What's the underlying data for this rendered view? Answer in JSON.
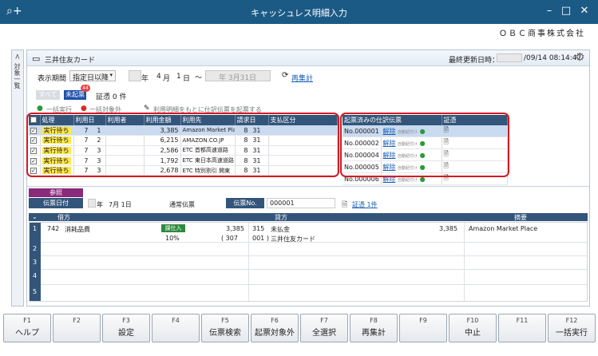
{
  "window": {
    "title": "キャッシュレス明細入力",
    "company": "ＯＢＣ商事株式会社"
  },
  "side_label": "対象一覧",
  "card": {
    "name": "三井住友カード",
    "updated_label": "最終更新日時：",
    "updated_value": "/09/14 08:14:47"
  },
  "filter": {
    "period_label": "表示期間",
    "period_select": "指定日以降",
    "from_year_label": "年",
    "from_month": "4",
    "from_month_label": "月",
    "from_day": "1",
    "from_day_label": "日",
    "tilde": "～",
    "to_value": "年  3月31日",
    "recalc_label": "再集計"
  },
  "tabs": {
    "all": "すべて",
    "unposted": "未起票",
    "badge": "44",
    "voucher": "証憑 0 件"
  },
  "actions": {
    "bulk_exec": "一括実行",
    "bulk_exclude": "一括対象外",
    "hint": "利用明細をもとに仕訳伝票を起票する"
  },
  "left_table": {
    "headers": [
      "",
      "処理",
      "利用日",
      "利用者",
      "利用金額",
      "利用先",
      "請求日",
      "支払区分"
    ],
    "rows": [
      {
        "status": "実行待ち",
        "m": "7",
        "d": "1",
        "amount": "3,385",
        "merchant": "Amazon Market Place",
        "bm": "8",
        "bd": "31"
      },
      {
        "status": "実行待ち",
        "m": "7",
        "d": "2",
        "amount": "6,215",
        "merchant": "AMAZON.CO.JP",
        "bm": "8",
        "bd": "31"
      },
      {
        "status": "実行待ち",
        "m": "7",
        "d": "3",
        "amount": "2,586",
        "merchant": "ETC 首都高速道路",
        "bm": "8",
        "bd": "31"
      },
      {
        "status": "実行待ち",
        "m": "7",
        "d": "3",
        "amount": "1,792",
        "merchant": "ETC 東日本高速道路 関東支社",
        "bm": "8",
        "bd": "31"
      },
      {
        "status": "実行待ち",
        "m": "7",
        "d": "3",
        "amount": "2,678",
        "merchant": "ETC 特別割引 開東",
        "bm": "8",
        "bd": "31"
      }
    ]
  },
  "right_table": {
    "headers": [
      "起票済みの仕訳伝票",
      "",
      "証憑"
    ],
    "rows": [
      {
        "no": "No.000001",
        "unlink": "解除",
        "auto": "自動紐付け"
      },
      {
        "no": "No.000002",
        "unlink": "解除",
        "auto": "自動紐付け"
      },
      {
        "no": "No.000004",
        "unlink": "解除",
        "auto": "自動紐付け"
      },
      {
        "no": "No.000005",
        "unlink": "解除",
        "auto": "自動紐付け"
      },
      {
        "no": "No.000006",
        "unlink": "解除",
        "auto": "自動紐付け"
      }
    ]
  },
  "voucher": {
    "ref_tag": "参照",
    "date_label": "伝票日付",
    "date_year": "年",
    "date_value": "7月  1日",
    "type": "通常伝票",
    "no_label": "伝票No.",
    "no_value": "000001",
    "evidence_link": "証憑 1件"
  },
  "journal": {
    "headers": {
      "debit": "借方",
      "credit": "貸方",
      "memo": "摘要"
    },
    "row": {
      "idx": "1",
      "d_code": "742",
      "d_name": "消耗品費",
      "tax_tag": "課仕入",
      "tax_rate": "10%",
      "d_amount": "3,385",
      "d_tax": "( 307",
      "d_tax_code": "001 )",
      "c_code": "315",
      "c_name": "未払金",
      "c_sub": "三井住友カード",
      "c_amount": "3,385",
      "memo": "Amazon Market Place"
    },
    "row_nums": [
      "2",
      "3",
      "4",
      "5"
    ]
  },
  "fkeys": [
    {
      "key": "F1",
      "label": "ヘルプ"
    },
    {
      "key": "F2",
      "label": ""
    },
    {
      "key": "F3",
      "label": "設定"
    },
    {
      "key": "F4",
      "label": ""
    },
    {
      "key": "F5",
      "label": "伝票検索"
    },
    {
      "key": "F6",
      "label": "起票対象外"
    },
    {
      "key": "F7",
      "label": "全選択"
    },
    {
      "key": "F8",
      "label": "再集計"
    },
    {
      "key": "F9",
      "label": ""
    },
    {
      "key": "F10",
      "label": "中止"
    },
    {
      "key": "F11",
      "label": ""
    },
    {
      "key": "F12",
      "label": "一括実行"
    }
  ]
}
